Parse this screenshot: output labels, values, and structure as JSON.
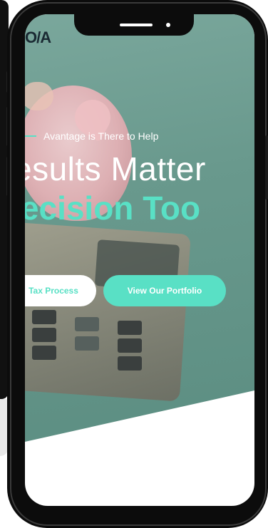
{
  "brand": {
    "logo_text": "O/A"
  },
  "hero": {
    "tagline": "Avantage is There to Help",
    "headline_line1": "esults Matter",
    "headline_line2": "recision Too",
    "buttons": {
      "process_label": "Tax Process",
      "portfolio_label": "View Our Portfolio"
    }
  },
  "colors": {
    "accent": "#59e0c5",
    "hero_background": "#6b9b90",
    "phone_frame": "#0c0c0c",
    "page_background": "#ffffff"
  },
  "icons": [
    "notch-speaker-icon",
    "notch-camera-icon"
  ]
}
